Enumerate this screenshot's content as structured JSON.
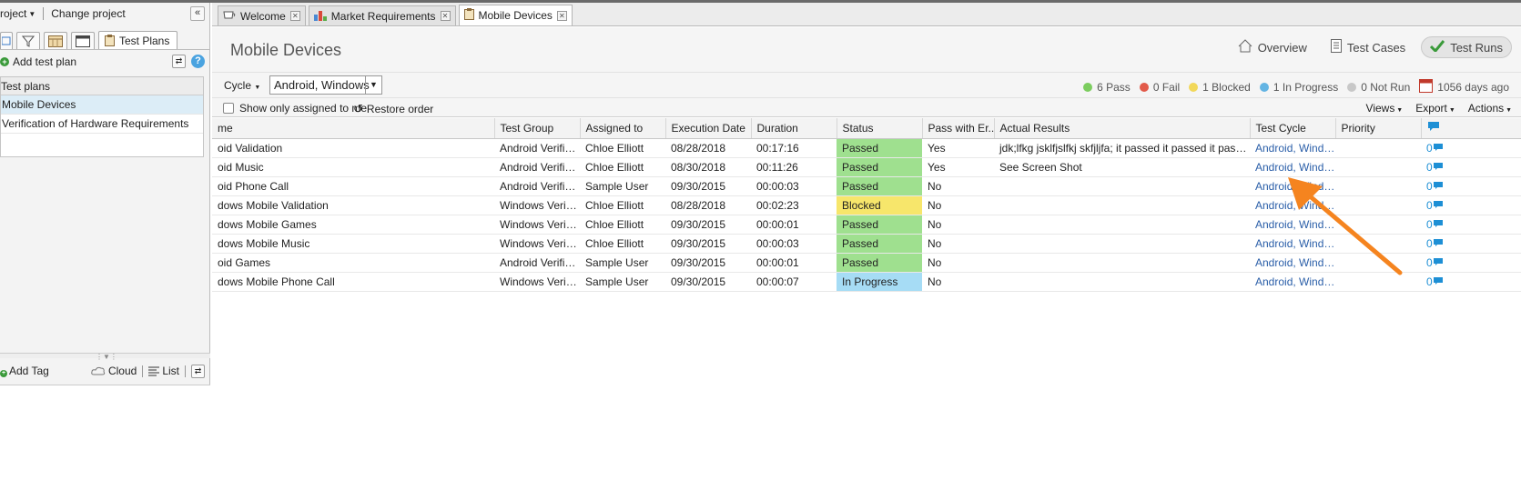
{
  "left": {
    "project_menu": "roject",
    "change_project": "Change project",
    "collapse": "«",
    "tab_test_plans": "Test Plans",
    "add_test_plan": "Add test plan",
    "help": "?",
    "plans_header": "Test plans",
    "plans": [
      {
        "label": "Mobile Devices",
        "selected": true
      },
      {
        "label": "Verification of Hardware Requirements",
        "selected": false
      }
    ],
    "add_tag": "Add Tag",
    "cloud": "Cloud",
    "list": "List"
  },
  "tabs": [
    {
      "label": "Welcome",
      "icon": "teacup-icon",
      "active": false
    },
    {
      "label": "Market Requirements",
      "icon": "bar-chart-icon",
      "active": false
    },
    {
      "label": "Mobile Devices",
      "icon": "clipboard-icon",
      "active": true
    }
  ],
  "header": {
    "title": "Mobile Devices",
    "views": [
      {
        "label": "Overview",
        "icon": "home-icon",
        "active": false
      },
      {
        "label": "Test Cases",
        "icon": "document-icon",
        "active": false
      },
      {
        "label": "Test Runs",
        "icon": "checkmark-icon",
        "active": true
      }
    ]
  },
  "filter": {
    "cycle_label": "Cycle",
    "cycle_value": "Android, Windows",
    "summary": [
      {
        "label": "6 Pass",
        "color": "#7ccd5f"
      },
      {
        "label": "0 Fail",
        "color": "#e25a4a"
      },
      {
        "label": "1 Blocked",
        "color": "#f2d85a"
      },
      {
        "label": "1 In Progress",
        "color": "#63b4e3"
      },
      {
        "label": "0 Not Run",
        "color": "#c8c8c8"
      }
    ],
    "days_ago": "1056 days ago"
  },
  "options": {
    "show_only_assigned": "Show only assigned to me",
    "restore_order": "Restore order",
    "views": "Views",
    "export": "Export",
    "actions": "Actions"
  },
  "grid": {
    "columns": [
      "me",
      "Test Group",
      "Assigned to",
      "Execution Date",
      "Duration",
      "Status",
      "Pass with Er...",
      "Actual Results",
      "Test Cycle",
      "Priority"
    ],
    "rows": [
      {
        "name": "oid Validation",
        "group": "Android Verifica...",
        "assigned": "Chloe Elliott",
        "date": "08/28/2018",
        "duration": "00:17:16",
        "status": "Passed",
        "status_key": "Passed",
        "pass_err": "Yes",
        "actual": "jdk;lfkg jsklfjslfkj skfjljfa; it passed it passed it passed it p...",
        "cycle": "Android, Windows",
        "priority": "",
        "comments": "0"
      },
      {
        "name": "oid Music",
        "group": "Android Verifica...",
        "assigned": "Chloe Elliott",
        "date": "08/30/2018",
        "duration": "00:11:26",
        "status": "Passed",
        "status_key": "Passed",
        "pass_err": "Yes",
        "actual": "See Screen Shot",
        "cycle": "Android, Windows",
        "priority": "",
        "comments": "0"
      },
      {
        "name": "oid Phone Call",
        "group": "Android Verifica...",
        "assigned": "Sample User",
        "date": "09/30/2015",
        "duration": "00:00:03",
        "status": "Passed",
        "status_key": "Passed",
        "pass_err": "No",
        "actual": "",
        "cycle": "Android, Windows",
        "priority": "",
        "comments": "0"
      },
      {
        "name": "dows Mobile Validation",
        "group": "Windows Verific...",
        "assigned": "Chloe Elliott",
        "date": "08/28/2018",
        "duration": "00:02:23",
        "status": "Blocked",
        "status_key": "Blocked",
        "pass_err": "No",
        "actual": "",
        "cycle": "Android, Windows",
        "priority": "",
        "comments": "0"
      },
      {
        "name": "dows Mobile Games",
        "group": "Windows Verific...",
        "assigned": "Chloe Elliott",
        "date": "09/30/2015",
        "duration": "00:00:01",
        "status": "Passed",
        "status_key": "Passed",
        "pass_err": "No",
        "actual": "",
        "cycle": "Android, Windows",
        "priority": "",
        "comments": "0"
      },
      {
        "name": "dows Mobile Music",
        "group": "Windows Verific...",
        "assigned": "Chloe Elliott",
        "date": "09/30/2015",
        "duration": "00:00:03",
        "status": "Passed",
        "status_key": "Passed",
        "pass_err": "No",
        "actual": "",
        "cycle": "Android, Windows",
        "priority": "",
        "comments": "0"
      },
      {
        "name": "oid Games",
        "group": "Android Verifica...",
        "assigned": "Sample User",
        "date": "09/30/2015",
        "duration": "00:00:01",
        "status": "Passed",
        "status_key": "Passed",
        "pass_err": "No",
        "actual": "",
        "cycle": "Android, Windows",
        "priority": "",
        "comments": "0"
      },
      {
        "name": "dows Mobile Phone Call",
        "group": "Windows Verific...",
        "assigned": "Sample User",
        "date": "09/30/2015",
        "duration": "00:00:07",
        "status": "In Progress",
        "status_key": "InProgress",
        "pass_err": "No",
        "actual": "",
        "cycle": "Android, Windows",
        "priority": "",
        "comments": "0"
      }
    ]
  },
  "annotation": {
    "color": "#f5841f"
  }
}
